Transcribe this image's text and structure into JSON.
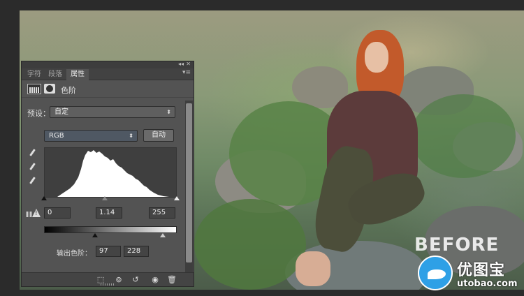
{
  "panel": {
    "tabs": [
      {
        "label": "字符",
        "active": false
      },
      {
        "label": "段落",
        "active": false
      },
      {
        "label": "属性",
        "active": true
      }
    ],
    "header_title": "色阶",
    "preset": {
      "label": "预设：",
      "value": "自定"
    },
    "channel": {
      "value": "RGB"
    },
    "auto_label": "自动",
    "input_levels": {
      "black": "0",
      "gamma": "1.14",
      "white": "255"
    },
    "output_levels": {
      "label": "输出色阶：",
      "black": "97",
      "white": "228"
    }
  },
  "overlay": {
    "before_text": "BEFORE",
    "watermark_cn": "优图宝",
    "watermark_url": "utobao.com"
  },
  "icons": [
    "collapse-icon",
    "close-icon",
    "panel-menu-icon",
    "histogram-icon",
    "mask-icon",
    "black-eyedropper-icon",
    "gray-eyedropper-icon",
    "white-eyedropper-icon",
    "clipping-warning-icon",
    "clip-to-layer-icon",
    "view-previous-icon",
    "reset-icon",
    "visibility-icon",
    "delete-icon"
  ],
  "colors": {
    "panel_bg": "#535353",
    "accent_blue": "#2ea0e6",
    "dark": "#2b2b2b"
  }
}
